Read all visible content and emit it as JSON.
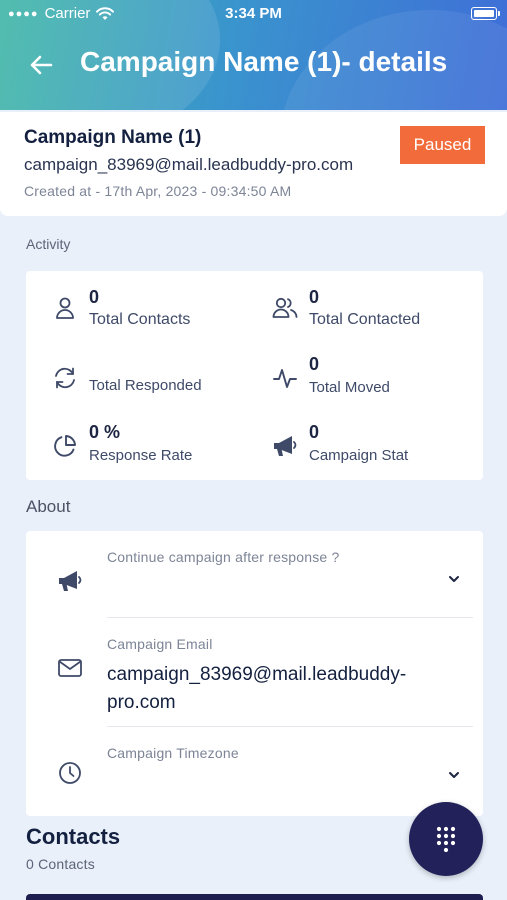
{
  "status_bar": {
    "carrier": "Carrier",
    "time": "3:34 PM"
  },
  "header": {
    "title": "Campaign Name (1)- details"
  },
  "campaign": {
    "name": "Campaign Name (1)",
    "email": "campaign_83969@mail.leadbuddy-pro.com",
    "created": "Created at - 17th Apr, 2023 - 09:34:50 AM",
    "status": "Paused"
  },
  "activity": {
    "label": "Activity",
    "stats": [
      {
        "value": "0",
        "label": "Total Contacts",
        "icon": "user-icon"
      },
      {
        "value": "0",
        "label": "Total Contacted",
        "icon": "users-icon"
      },
      {
        "value": "",
        "label": "Total Responded",
        "icon": "refresh-icon"
      },
      {
        "value": "0",
        "label": "Total Moved",
        "icon": "activity-icon"
      },
      {
        "value": "0 %",
        "label": "Response Rate",
        "icon": "pie-chart-icon"
      },
      {
        "value": "0",
        "label": "Campaign Stat",
        "icon": "megaphone-icon"
      }
    ]
  },
  "about": {
    "label": "About",
    "continue_label": "Continue campaign after response ?",
    "email_label": "Campaign Email",
    "email_value": "campaign_83969@mail.leadbuddy-pro.com",
    "timezone_label": "Campaign Timezone"
  },
  "contacts": {
    "title": "Contacts",
    "count": "0 Contacts"
  },
  "colors": {
    "status_badge": "#f26b3a",
    "fab": "#22215a",
    "background": "#e9f0fa"
  }
}
